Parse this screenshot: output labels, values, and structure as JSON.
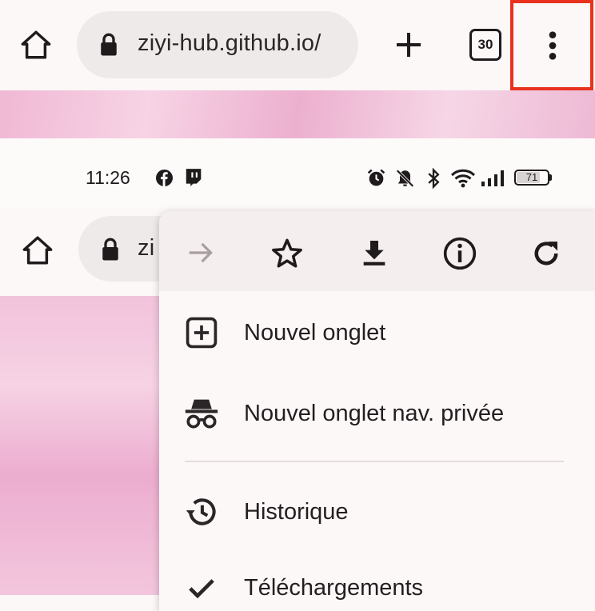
{
  "browser": {
    "url": "ziyi-hub.github.io/",
    "tab_count": "30"
  },
  "status_bar": {
    "time": "11:26",
    "battery": "71"
  },
  "second_bar": {
    "url_partial": "zi"
  },
  "menu": {
    "items": [
      {
        "label": "Nouvel onglet",
        "icon": "new-tab-icon"
      },
      {
        "label": "Nouvel onglet nav. privée",
        "icon": "incognito-icon"
      },
      {
        "label": "Historique",
        "icon": "history-icon"
      },
      {
        "label": "Téléchargements",
        "icon": "check-icon"
      }
    ]
  },
  "colors": {
    "highlight": "#e8321e",
    "menu_bg": "#fdf8f8",
    "menu_header_bg": "#f5eeee",
    "page_pink": "#f2c3dc"
  }
}
